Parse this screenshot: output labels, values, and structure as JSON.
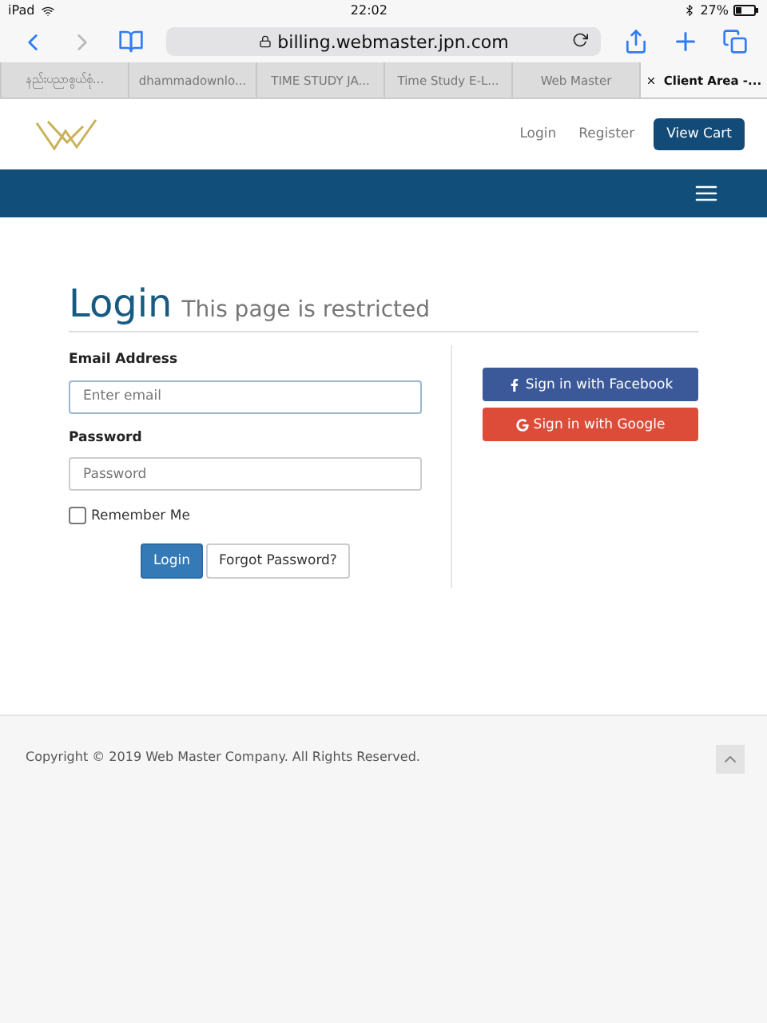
{
  "status_bar": {
    "device": "iPad",
    "time": "22:02",
    "battery": "27%"
  },
  "browser": {
    "url": "billing.webmaster.jpn.com"
  },
  "tabs": [
    {
      "label": "နည်းပညာစွယ်စုံ…",
      "selected": false
    },
    {
      "label": "dhammadownlo...",
      "selected": false
    },
    {
      "label": "TIME STUDY JA...",
      "selected": false
    },
    {
      "label": "Time Study E-L...",
      "selected": false
    },
    {
      "label": "Web Master",
      "selected": false
    },
    {
      "label": "Client Area -...",
      "selected": true
    }
  ],
  "header": {
    "links": [
      "Login",
      "Register"
    ],
    "cart_button": "View Cart"
  },
  "page": {
    "title": "Login",
    "subtitle": "This page is restricted",
    "email": {
      "label": "Email Address",
      "placeholder": "Enter email"
    },
    "password": {
      "label": "Password",
      "placeholder": "Password"
    },
    "remember": {
      "label": "Remember Me",
      "checked": false
    },
    "login_button": "Login",
    "forgot_button": "Forgot Password?",
    "social": [
      {
        "kind": "facebook",
        "label": "Sign in with Facebook"
      },
      {
        "kind": "google",
        "label": "Sign in with Google"
      }
    ]
  },
  "footer": {
    "copyright": "Copyright © 2019 Web Master Company. All Rights Reserved."
  }
}
